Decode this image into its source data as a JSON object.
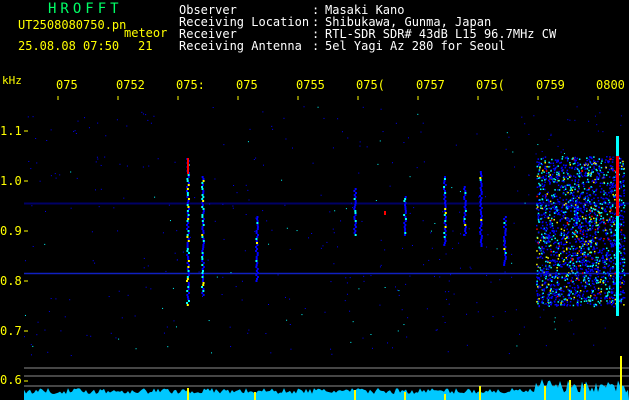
{
  "header": {
    "brand": "HROFFT",
    "file_name": "UT2508080750.pn",
    "detection_label": "meteor",
    "date_time": "25.08.08 07:50",
    "count": "21"
  },
  "station_info": [
    {
      "label": "Observer",
      "sep": ":",
      "value": "Masaki Kano"
    },
    {
      "label": "Receiving Location",
      "sep": ":",
      "value": "Shibukawa, Gunma, Japan"
    },
    {
      "label": "Receiver",
      "sep": ":",
      "value": "RTL-SDR SDR# 43dB L15 96.7MHz CW"
    },
    {
      "label": "Receiving Antenna",
      "sep": ":",
      "value": "5el Yagi Az 280 for Seoul"
    }
  ],
  "chart_data": {
    "type": "heatmap",
    "ylabel": "kHz",
    "y_ticks": [
      "1.1",
      "1.0",
      "0.9",
      "0.8",
      "0.7",
      "0.6"
    ],
    "x_ticks": [
      "075",
      "0752",
      "075:",
      "075",
      "0755",
      "075(",
      "0757",
      "075(",
      "0759",
      "0800"
    ],
    "background": "#000000",
    "tick_color": "#ffff00",
    "colormap": [
      "#000040",
      "#0000ff",
      "#00ffff",
      "#ffff00",
      "#ff0000"
    ],
    "continuous_carrier_khz": 0.815,
    "faint_band_khz": 0.955
  }
}
